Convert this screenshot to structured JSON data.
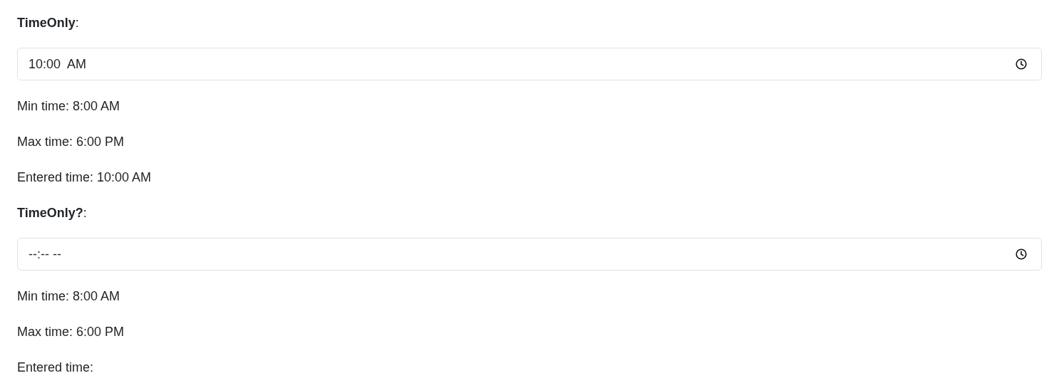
{
  "sections": [
    {
      "label": "**TimeOnly**:",
      "field": {
        "value": "10:00  AM"
      },
      "lines": [
        "Min time: 8:00 AM",
        "Max time: 6:00 PM",
        "Entered time: 10:00 AM"
      ]
    },
    {
      "label": "**TimeOnly?**:",
      "field": {
        "placeholder": "--:-- --"
      },
      "lines": [
        "Min time: 8:00 AM",
        "Max time: 6:00 PM",
        "Entered time:"
      ]
    }
  ]
}
